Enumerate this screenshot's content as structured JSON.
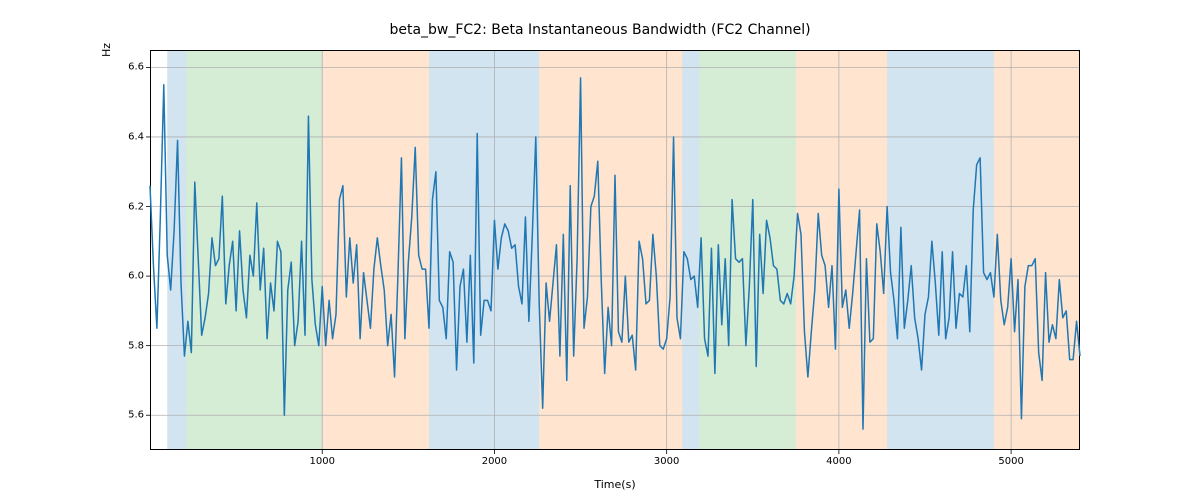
{
  "chart_data": {
    "type": "line",
    "title": "beta_bw_FC2: Beta Instantaneous Bandwidth (FC2 Channel)",
    "xlabel": "Time(s)",
    "ylabel": "Hz",
    "xlim": [
      0,
      5400
    ],
    "ylim": [
      5.5,
      6.65
    ],
    "xticks": [
      1000,
      2000,
      3000,
      4000,
      5000
    ],
    "yticks": [
      5.6,
      5.8,
      6.0,
      6.2,
      6.4,
      6.6
    ],
    "bands": [
      {
        "x0": 100,
        "x1": 210,
        "color": "blue"
      },
      {
        "x0": 210,
        "x1": 1000,
        "color": "green"
      },
      {
        "x0": 1000,
        "x1": 1620,
        "color": "orange"
      },
      {
        "x0": 1620,
        "x1": 2260,
        "color": "blue"
      },
      {
        "x0": 2260,
        "x1": 3090,
        "color": "orange"
      },
      {
        "x0": 3090,
        "x1": 3190,
        "color": "blue"
      },
      {
        "x0": 3190,
        "x1": 3750,
        "color": "green"
      },
      {
        "x0": 3750,
        "x1": 4280,
        "color": "orange"
      },
      {
        "x0": 4280,
        "x1": 4900,
        "color": "blue"
      },
      {
        "x0": 4900,
        "x1": 5400,
        "color": "orange"
      }
    ],
    "band_colors": {
      "blue": "rgba(31,119,180,0.20)",
      "green": "rgba(44,160,44,0.20)",
      "orange": "rgba(255,127,14,0.20)"
    },
    "line_color": "#1f77b4",
    "x": [
      0,
      20,
      40,
      60,
      80,
      100,
      120,
      140,
      160,
      180,
      200,
      220,
      240,
      260,
      280,
      300,
      320,
      340,
      360,
      380,
      400,
      420,
      440,
      460,
      480,
      500,
      520,
      540,
      560,
      580,
      600,
      620,
      640,
      660,
      680,
      700,
      720,
      740,
      760,
      780,
      800,
      820,
      840,
      860,
      880,
      900,
      920,
      940,
      960,
      980,
      1000,
      1020,
      1040,
      1060,
      1080,
      1100,
      1120,
      1140,
      1160,
      1180,
      1200,
      1220,
      1240,
      1260,
      1280,
      1300,
      1320,
      1340,
      1360,
      1380,
      1400,
      1420,
      1440,
      1460,
      1480,
      1500,
      1520,
      1540,
      1560,
      1580,
      1600,
      1620,
      1640,
      1660,
      1680,
      1700,
      1720,
      1740,
      1760,
      1780,
      1800,
      1820,
      1840,
      1860,
      1880,
      1900,
      1920,
      1940,
      1960,
      1980,
      2000,
      2020,
      2040,
      2060,
      2080,
      2100,
      2120,
      2140,
      2160,
      2180,
      2200,
      2220,
      2240,
      2260,
      2280,
      2300,
      2320,
      2340,
      2360,
      2380,
      2400,
      2420,
      2440,
      2460,
      2480,
      2500,
      2520,
      2540,
      2560,
      2580,
      2600,
      2620,
      2640,
      2660,
      2680,
      2700,
      2720,
      2740,
      2760,
      2780,
      2800,
      2820,
      2840,
      2860,
      2880,
      2900,
      2920,
      2940,
      2960,
      2980,
      3000,
      3020,
      3040,
      3060,
      3080,
      3100,
      3120,
      3140,
      3160,
      3180,
      3200,
      3220,
      3240,
      3260,
      3280,
      3300,
      3320,
      3340,
      3360,
      3380,
      3400,
      3420,
      3440,
      3460,
      3480,
      3500,
      3520,
      3540,
      3560,
      3580,
      3600,
      3620,
      3640,
      3660,
      3680,
      3700,
      3720,
      3740,
      3760,
      3780,
      3800,
      3820,
      3840,
      3860,
      3880,
      3900,
      3920,
      3940,
      3960,
      3980,
      4000,
      4020,
      4040,
      4060,
      4080,
      4100,
      4120,
      4140,
      4160,
      4180,
      4200,
      4220,
      4240,
      4260,
      4280,
      4300,
      4320,
      4340,
      4360,
      4380,
      4400,
      4420,
      4440,
      4460,
      4480,
      4500,
      4520,
      4540,
      4560,
      4580,
      4600,
      4620,
      4640,
      4660,
      4680,
      4700,
      4720,
      4740,
      4760,
      4780,
      4800,
      4820,
      4840,
      4860,
      4880,
      4900,
      4920,
      4940,
      4960,
      4980,
      5000,
      5020,
      5040,
      5060,
      5080,
      5100,
      5120,
      5140,
      5160,
      5180,
      5200,
      5220,
      5240,
      5260,
      5280,
      5300,
      5320,
      5340,
      5360,
      5380,
      5400
    ],
    "values": [
      6.26,
      6.03,
      5.85,
      6.17,
      6.55,
      6.06,
      5.96,
      6.13,
      6.39,
      5.98,
      5.77,
      5.87,
      5.78,
      6.27,
      6.05,
      5.83,
      5.88,
      5.95,
      6.11,
      6.03,
      6.05,
      6.23,
      5.92,
      6.03,
      6.1,
      5.9,
      6.13,
      5.96,
      5.88,
      6.06,
      6.0,
      6.21,
      5.96,
      6.08,
      5.82,
      5.98,
      5.9,
      6.1,
      6.07,
      5.6,
      5.96,
      6.04,
      5.8,
      5.87,
      6.1,
      5.83,
      6.46,
      5.99,
      5.86,
      5.8,
      5.97,
      5.8,
      5.93,
      5.82,
      5.89,
      6.22,
      6.26,
      5.94,
      6.11,
      5.98,
      6.09,
      5.82,
      6.01,
      5.93,
      5.85,
      6.02,
      6.11,
      6.03,
      5.96,
      5.8,
      5.89,
      5.71,
      6.01,
      6.34,
      5.82,
      6.04,
      6.17,
      6.37,
      6.06,
      6.02,
      6.02,
      5.85,
      6.22,
      6.3,
      5.93,
      5.91,
      5.82,
      6.07,
      6.04,
      5.73,
      5.97,
      6.02,
      5.81,
      6.06,
      5.75,
      6.41,
      5.83,
      5.93,
      5.93,
      5.9,
      6.16,
      6.02,
      6.11,
      6.15,
      6.13,
      6.08,
      6.09,
      5.97,
      5.92,
      6.17,
      5.87,
      6.12,
      6.4,
      5.92,
      5.62,
      5.98,
      5.87,
      5.98,
      6.09,
      5.77,
      6.12,
      5.7,
      6.26,
      5.77,
      6.05,
      6.57,
      5.85,
      5.94,
      6.2,
      6.23,
      6.33,
      5.99,
      5.72,
      5.91,
      5.8,
      6.29,
      5.84,
      5.81,
      6.0,
      5.81,
      5.83,
      5.73,
      6.1,
      6.05,
      5.92,
      5.93,
      6.12,
      6.0,
      5.8,
      5.79,
      5.82,
      5.94,
      6.4,
      5.88,
      5.82,
      6.07,
      6.05,
      5.99,
      6.0,
      5.91,
      6.11,
      5.82,
      5.77,
      6.08,
      5.72,
      6.09,
      5.86,
      6.05,
      5.8,
      6.22,
      6.05,
      6.04,
      6.05,
      5.8,
      5.97,
      6.22,
      5.74,
      6.12,
      5.95,
      6.16,
      6.11,
      6.03,
      6.02,
      5.93,
      5.92,
      5.95,
      5.92,
      6.0,
      6.18,
      6.12,
      5.84,
      5.71,
      5.84,
      5.96,
      6.18,
      6.06,
      6.03,
      5.91,
      6.03,
      5.79,
      6.25,
      5.91,
      5.96,
      5.85,
      5.95,
      6.07,
      6.19,
      5.56,
      6.05,
      5.81,
      5.82,
      6.15,
      6.07,
      5.95,
      6.2,
      6.01,
      5.93,
      5.82,
      6.14,
      5.85,
      5.93,
      6.03,
      5.88,
      5.82,
      5.73,
      5.89,
      5.94,
      6.1,
      5.98,
      5.83,
      6.07,
      5.82,
      5.88,
      6.07,
      5.85,
      5.95,
      5.94,
      6.03,
      5.84,
      6.19,
      6.32,
      6.34,
      6.01,
      5.99,
      6.01,
      5.94,
      6.12,
      5.93,
      5.86,
      5.91,
      6.05,
      5.84,
      5.99,
      5.59,
      5.97,
      6.03,
      6.03,
      6.05,
      5.78,
      5.7,
      6.01,
      5.81,
      5.86,
      5.82,
      5.99,
      5.88,
      5.9,
      5.76,
      5.76,
      5.87,
      5.77
    ]
  }
}
